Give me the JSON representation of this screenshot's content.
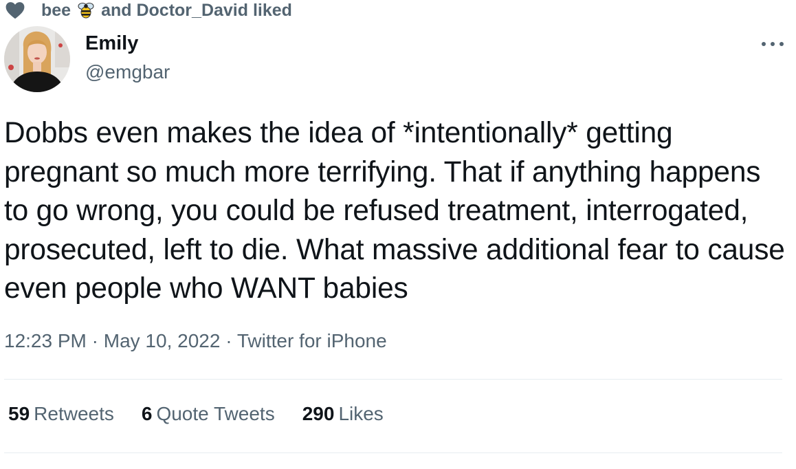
{
  "social_context": {
    "user1": "bee",
    "user1_emoji_icon": "bee-emoji-icon",
    "rest": "and Doctor_David liked",
    "heart_icon": "heart-icon",
    "heart_color": "#536471"
  },
  "author": {
    "name": "Emily",
    "handle": "@emgbar",
    "avatar_icon": "profile-photo"
  },
  "tweet": {
    "text": "Dobbs even makes the idea of *intentionally* getting pregnant so much more terrifying. That if anything happens to go wrong, you could be refused treatment, interrogated, prosecuted, left to die. What massive additional fear to cause even people who WANT babies"
  },
  "meta": {
    "time": "12:23 PM",
    "sep1": "·",
    "date": "May 10, 2022",
    "sep2": "·",
    "source": "Twitter for iPhone"
  },
  "stats": {
    "retweets_count": "59",
    "retweets_label": "Retweets",
    "quotes_count": "6",
    "quotes_label": "Quote Tweets",
    "likes_count": "290",
    "likes_label": "Likes"
  },
  "colors": {
    "primary_text": "#0f1419",
    "secondary_text": "#536471",
    "divider": "#e6ecf0"
  }
}
